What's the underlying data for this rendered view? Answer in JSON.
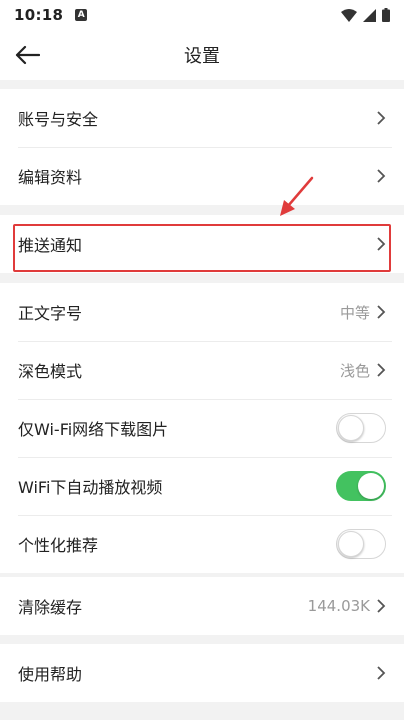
{
  "status_bar": {
    "time": "10:18",
    "notification_icon": "A"
  },
  "header": {
    "title": "设置"
  },
  "groups": [
    {
      "items": [
        {
          "label": "账号与安全"
        },
        {
          "label": "编辑资料"
        }
      ]
    },
    {
      "items": [
        {
          "label": "推送通知"
        }
      ]
    },
    {
      "items": [
        {
          "label": "正文字号",
          "value": "中等"
        },
        {
          "label": "深色模式",
          "value": "浅色"
        },
        {
          "label": "仅Wi-Fi网络下载图片",
          "toggle": false
        },
        {
          "label": "WiFi下自动播放视频",
          "toggle": true
        },
        {
          "label": "个性化推荐",
          "toggle": false
        }
      ]
    },
    {
      "items": [
        {
          "label": "清除缓存",
          "value": "144.03K"
        }
      ]
    },
    {
      "items": [
        {
          "label": "使用帮助"
        }
      ]
    }
  ],
  "colors": {
    "toggle_on": "#43c260",
    "highlight": "#e03b3b"
  }
}
